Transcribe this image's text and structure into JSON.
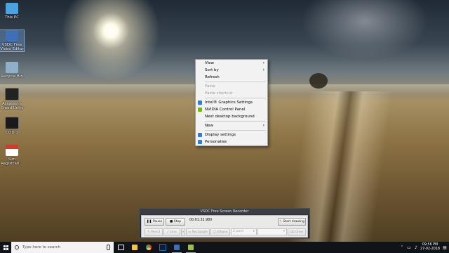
{
  "desktop": {
    "icons": [
      {
        "label": "This PC",
        "icon": "this-pc-icon",
        "color": "#4aa3df"
      },
      {
        "label": "VSDC Free Video Editor",
        "icon": "vsdc-editor-icon",
        "color": "#3f6fb5"
      },
      {
        "label": "Recycle Bin",
        "icon": "recycle-bin-icon",
        "color": "#8fb0c8"
      },
      {
        "label": "Assassin's Creed Unity",
        "icon": "game-icon",
        "color": "#222222"
      },
      {
        "label": "COD 1",
        "icon": "cod-icon",
        "color": "#1a1a1a"
      },
      {
        "label": "Sim Registrati...",
        "icon": "pdf-icon",
        "color": "#d23a2a"
      }
    ]
  },
  "context_menu": {
    "items": [
      {
        "label": "View",
        "has_arrow": true,
        "disabled": false
      },
      {
        "label": "Sort by",
        "has_arrow": true,
        "disabled": false
      },
      {
        "label": "Refresh",
        "has_arrow": false,
        "disabled": false
      },
      {
        "label": "Paste",
        "disabled": true
      },
      {
        "label": "Paste shortcut",
        "disabled": true
      },
      {
        "label": "Intel® Graphics Settings",
        "icon_color": "#2d7fd3"
      },
      {
        "label": "NVIDIA Control Panel",
        "icon_color": "#76b900"
      },
      {
        "label": "Next desktop background"
      },
      {
        "label": "New",
        "has_arrow": true
      },
      {
        "label": "Display settings",
        "icon_color": "#2d7fd3"
      },
      {
        "label": "Personalise",
        "icon_color": "#2d7fd3"
      }
    ],
    "arrow_glyph": "›"
  },
  "recorder": {
    "title": "VSDC Free Screen Recorder",
    "pause_label": "Pause",
    "stop_label": "Stop",
    "time": "00:01:32.980",
    "start_drawing_label": "Start drawing",
    "pencil_label": "Pencil",
    "line_label": "Line",
    "rectangle_label": "Rectangle",
    "ellipse_label": "Ellipse",
    "width_value": "2 pixel",
    "clear_label": "Clear"
  },
  "taskbar": {
    "search_placeholder": "Type here to search",
    "apps": [
      {
        "icon": "task-view-icon",
        "color": "#ffffff"
      },
      {
        "icon": "file-explorer-icon",
        "color": "#f3c04a"
      },
      {
        "icon": "chrome-icon",
        "color": "#e0463a"
      },
      {
        "icon": "photoshop-icon",
        "color": "#2b6cb0"
      },
      {
        "icon": "vsdc-taskbar-icon",
        "color": "#3f6fb5"
      },
      {
        "icon": "recorder-taskbar-icon",
        "color": "#9bbf4a"
      }
    ],
    "time": "09:56 PM",
    "date": "27-02-2018"
  }
}
